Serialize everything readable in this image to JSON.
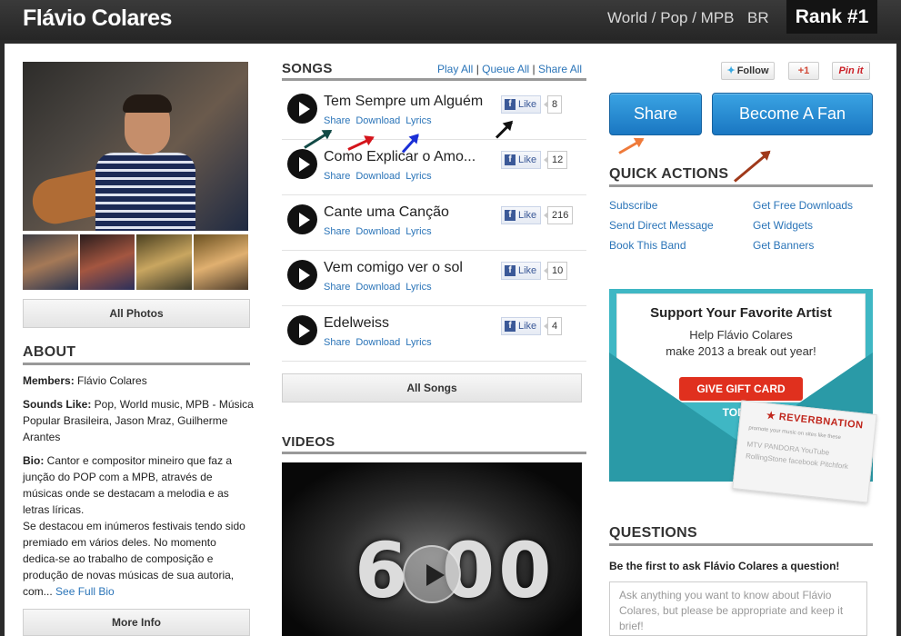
{
  "header": {
    "artist_name": "Flávio Colares",
    "genre": "World / Pop / MPB",
    "country": "BR",
    "rank": "Rank #1"
  },
  "left": {
    "all_photos_label": "All Photos",
    "about_title": "ABOUT",
    "members_label": "Members:",
    "members_value": " Flávio Colares",
    "sounds_like_label": "Sounds Like:",
    "sounds_like_value": " Pop, World music, MPB - Música Popular Brasileira, Jason Mraz, Guilherme Arantes",
    "bio_label": "Bio:",
    "bio_value": " Cantor e compositor mineiro que faz a junção do POP com a MPB, através de músicas onde se destacam a melodia e as letras líricas.",
    "bio_value_2": "Se destacou em inúmeros festivais tendo sido premiado em vários deles. No momento dedica-se ao trabalho de composição e produção de novas músicas de sua autoria, com...",
    "see_full_bio": "See Full Bio",
    "more_info_label": "More Info"
  },
  "songs": {
    "title": "SONGS",
    "play_all": "Play All",
    "queue_all": "Queue All",
    "share_all": "Share All",
    "separator": " | ",
    "link_share": "Share",
    "link_download": "Download",
    "link_lyrics": "Lyrics",
    "like_label": "Like",
    "items": [
      {
        "title": "Tem Sempre um Alguém",
        "likes": "8"
      },
      {
        "title": "Como Explicar o Amo...",
        "likes": "12"
      },
      {
        "title": "Cante uma Canção",
        "likes": "216"
      },
      {
        "title": "Vem comigo ver o sol",
        "likes": "10"
      },
      {
        "title": "Edelweiss",
        "likes": "4"
      }
    ],
    "all_songs_label": "All Songs"
  },
  "videos": {
    "title": "VIDEOS",
    "countdown_text": "6 00"
  },
  "right": {
    "follow_label": "Follow",
    "gplus_label": "+1",
    "pinit_label": "Pin it",
    "share_button": "Share",
    "fan_button": "Become A Fan",
    "quick_actions_title": "QUICK ACTIONS",
    "actions": [
      "Subscribe",
      "Get Free Downloads",
      "Send Direct Message",
      "Get Widgets",
      "Book This Band",
      "Get Banners"
    ],
    "gift_title": "Support Your Favorite Artist",
    "gift_sub_1": "Help Flávio Colares",
    "gift_sub_2": "make 2013 a break out year!",
    "gift_button": "GIVE GIFT CARD TODAY",
    "card_brand": "REVERBNATION",
    "card_line": "promote your music on sites like these",
    "card_logos": "MTV  PANDORA  YouTube  RollingStone  facebook  Pitchfork",
    "questions_title": "QUESTIONS",
    "questions_prompt": "Be the first to ask Flávio Colares a question!",
    "question_placeholder": "Ask anything you want to know about Flávio Colares, but please be appropriate and keep it brief!"
  },
  "colors": {
    "link": "#2a74b8",
    "button_blue": "#1a77c2",
    "gift_red": "#e0301e",
    "envelope": "#3fb7c4"
  }
}
